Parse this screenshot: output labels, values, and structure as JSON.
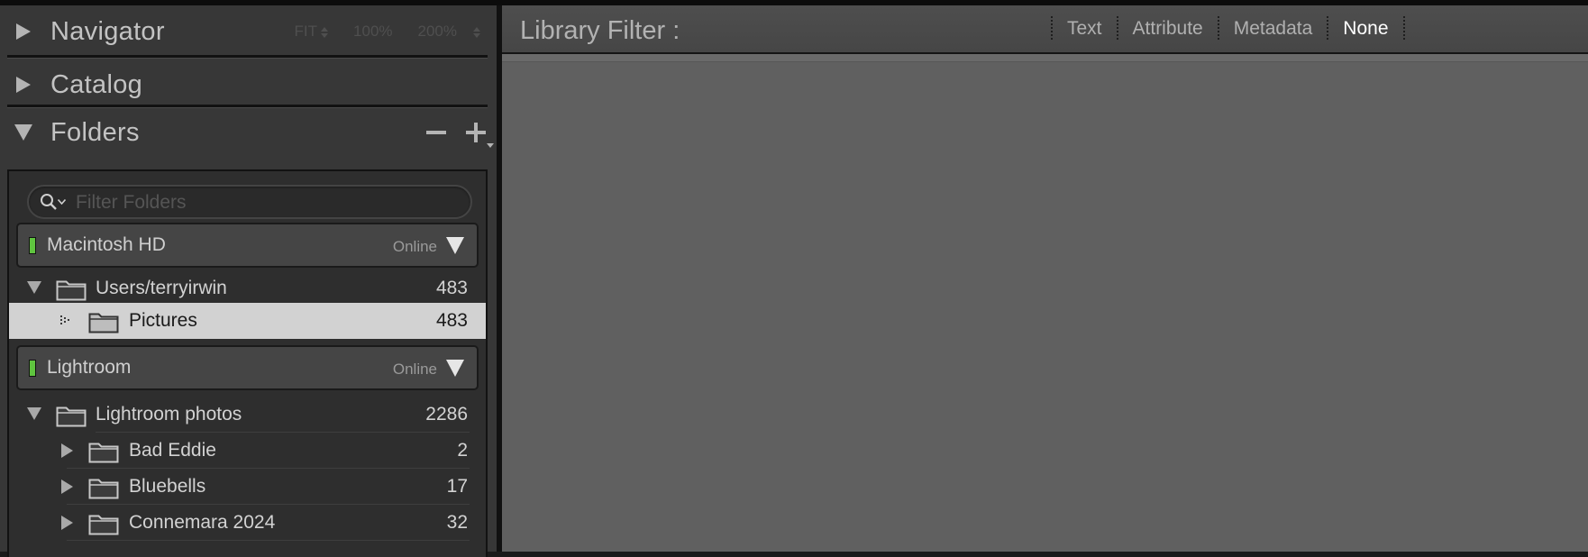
{
  "navigator": {
    "title": "Navigator",
    "options": [
      "FIT",
      "100%",
      "200%"
    ]
  },
  "catalog": {
    "title": "Catalog"
  },
  "folders": {
    "title": "Folders",
    "filter_placeholder": "Filter Folders",
    "volumes": [
      {
        "name": "Macintosh HD",
        "status": "Online",
        "rows": [
          {
            "name": "Users/terryirwin",
            "count": "483",
            "expanded": true
          },
          {
            "name": "Pictures",
            "count": "483",
            "selected": true
          }
        ]
      },
      {
        "name": "Lightroom",
        "status": "Online",
        "rows": [
          {
            "name": "Lightroom photos",
            "count": "2286",
            "expanded": true
          },
          {
            "name": "Bad Eddie",
            "count": "2"
          },
          {
            "name": "Bluebells",
            "count": "17"
          },
          {
            "name": "Connemara 2024",
            "count": "32"
          }
        ]
      }
    ]
  },
  "library_filter": {
    "label": "Library Filter :",
    "tabs": [
      "Text",
      "Attribute",
      "Metadata",
      "None"
    ],
    "active_tab": "None"
  },
  "colors": {
    "panel_bg": "#373737",
    "content_bg": "#606060",
    "selected_row": "#d2d2d2",
    "online_light": "#5fc43f"
  }
}
